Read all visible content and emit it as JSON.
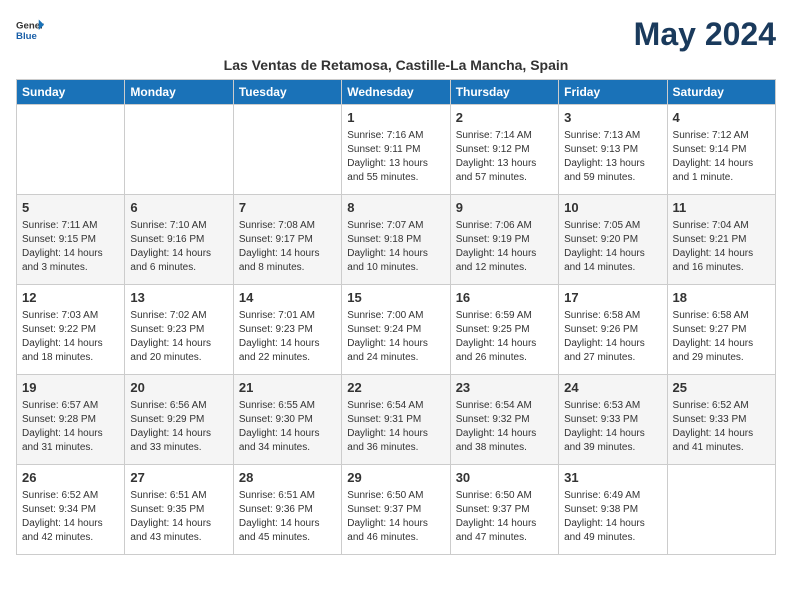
{
  "header": {
    "logo_line1": "General",
    "logo_line2": "Blue",
    "month_title": "May 2024",
    "subtitle": "Las Ventas de Retamosa, Castille-La Mancha, Spain"
  },
  "days_of_week": [
    "Sunday",
    "Monday",
    "Tuesday",
    "Wednesday",
    "Thursday",
    "Friday",
    "Saturday"
  ],
  "weeks": [
    [
      {
        "day": "",
        "info": ""
      },
      {
        "day": "",
        "info": ""
      },
      {
        "day": "",
        "info": ""
      },
      {
        "day": "1",
        "info": "Sunrise: 7:16 AM\nSunset: 9:11 PM\nDaylight: 13 hours and 55 minutes."
      },
      {
        "day": "2",
        "info": "Sunrise: 7:14 AM\nSunset: 9:12 PM\nDaylight: 13 hours and 57 minutes."
      },
      {
        "day": "3",
        "info": "Sunrise: 7:13 AM\nSunset: 9:13 PM\nDaylight: 13 hours and 59 minutes."
      },
      {
        "day": "4",
        "info": "Sunrise: 7:12 AM\nSunset: 9:14 PM\nDaylight: 14 hours and 1 minute."
      }
    ],
    [
      {
        "day": "5",
        "info": "Sunrise: 7:11 AM\nSunset: 9:15 PM\nDaylight: 14 hours and 3 minutes."
      },
      {
        "day": "6",
        "info": "Sunrise: 7:10 AM\nSunset: 9:16 PM\nDaylight: 14 hours and 6 minutes."
      },
      {
        "day": "7",
        "info": "Sunrise: 7:08 AM\nSunset: 9:17 PM\nDaylight: 14 hours and 8 minutes."
      },
      {
        "day": "8",
        "info": "Sunrise: 7:07 AM\nSunset: 9:18 PM\nDaylight: 14 hours and 10 minutes."
      },
      {
        "day": "9",
        "info": "Sunrise: 7:06 AM\nSunset: 9:19 PM\nDaylight: 14 hours and 12 minutes."
      },
      {
        "day": "10",
        "info": "Sunrise: 7:05 AM\nSunset: 9:20 PM\nDaylight: 14 hours and 14 minutes."
      },
      {
        "day": "11",
        "info": "Sunrise: 7:04 AM\nSunset: 9:21 PM\nDaylight: 14 hours and 16 minutes."
      }
    ],
    [
      {
        "day": "12",
        "info": "Sunrise: 7:03 AM\nSunset: 9:22 PM\nDaylight: 14 hours and 18 minutes."
      },
      {
        "day": "13",
        "info": "Sunrise: 7:02 AM\nSunset: 9:23 PM\nDaylight: 14 hours and 20 minutes."
      },
      {
        "day": "14",
        "info": "Sunrise: 7:01 AM\nSunset: 9:23 PM\nDaylight: 14 hours and 22 minutes."
      },
      {
        "day": "15",
        "info": "Sunrise: 7:00 AM\nSunset: 9:24 PM\nDaylight: 14 hours and 24 minutes."
      },
      {
        "day": "16",
        "info": "Sunrise: 6:59 AM\nSunset: 9:25 PM\nDaylight: 14 hours and 26 minutes."
      },
      {
        "day": "17",
        "info": "Sunrise: 6:58 AM\nSunset: 9:26 PM\nDaylight: 14 hours and 27 minutes."
      },
      {
        "day": "18",
        "info": "Sunrise: 6:58 AM\nSunset: 9:27 PM\nDaylight: 14 hours and 29 minutes."
      }
    ],
    [
      {
        "day": "19",
        "info": "Sunrise: 6:57 AM\nSunset: 9:28 PM\nDaylight: 14 hours and 31 minutes."
      },
      {
        "day": "20",
        "info": "Sunrise: 6:56 AM\nSunset: 9:29 PM\nDaylight: 14 hours and 33 minutes."
      },
      {
        "day": "21",
        "info": "Sunrise: 6:55 AM\nSunset: 9:30 PM\nDaylight: 14 hours and 34 minutes."
      },
      {
        "day": "22",
        "info": "Sunrise: 6:54 AM\nSunset: 9:31 PM\nDaylight: 14 hours and 36 minutes."
      },
      {
        "day": "23",
        "info": "Sunrise: 6:54 AM\nSunset: 9:32 PM\nDaylight: 14 hours and 38 minutes."
      },
      {
        "day": "24",
        "info": "Sunrise: 6:53 AM\nSunset: 9:33 PM\nDaylight: 14 hours and 39 minutes."
      },
      {
        "day": "25",
        "info": "Sunrise: 6:52 AM\nSunset: 9:33 PM\nDaylight: 14 hours and 41 minutes."
      }
    ],
    [
      {
        "day": "26",
        "info": "Sunrise: 6:52 AM\nSunset: 9:34 PM\nDaylight: 14 hours and 42 minutes."
      },
      {
        "day": "27",
        "info": "Sunrise: 6:51 AM\nSunset: 9:35 PM\nDaylight: 14 hours and 43 minutes."
      },
      {
        "day": "28",
        "info": "Sunrise: 6:51 AM\nSunset: 9:36 PM\nDaylight: 14 hours and 45 minutes."
      },
      {
        "day": "29",
        "info": "Sunrise: 6:50 AM\nSunset: 9:37 PM\nDaylight: 14 hours and 46 minutes."
      },
      {
        "day": "30",
        "info": "Sunrise: 6:50 AM\nSunset: 9:37 PM\nDaylight: 14 hours and 47 minutes."
      },
      {
        "day": "31",
        "info": "Sunrise: 6:49 AM\nSunset: 9:38 PM\nDaylight: 14 hours and 49 minutes."
      },
      {
        "day": "",
        "info": ""
      }
    ]
  ]
}
